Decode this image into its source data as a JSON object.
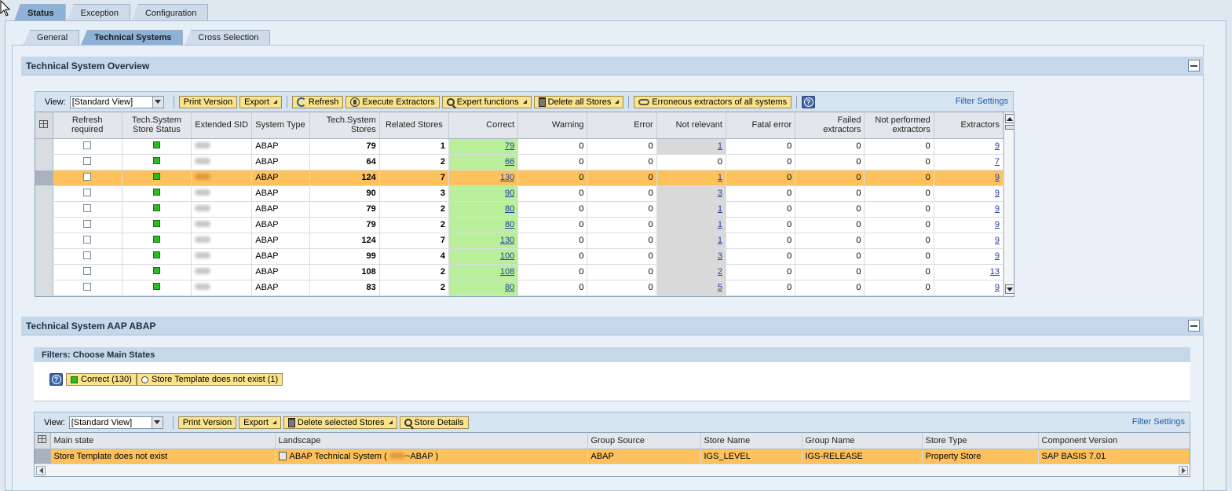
{
  "main_tabs": [
    "Status",
    "Exception",
    "Configuration"
  ],
  "sub_tabs": [
    "General",
    "Technical Systems",
    "Cross Selection"
  ],
  "overview": {
    "title": "Technical System Overview",
    "toolbar": {
      "view_label": "View:",
      "view_value": "[Standard View]",
      "print": "Print Version",
      "export": "Export",
      "refresh": "Refresh",
      "execute": "Execute Extractors",
      "expert": "Expert functions",
      "delete_all": "Delete all Stores",
      "erroneous": "Erroneous extractors of all systems",
      "help": "?",
      "filter_settings": "Filter Settings"
    },
    "columns": {
      "refresh": "Refresh required",
      "status": "Tech.System Store Status",
      "sid": "Extended SID",
      "systype": "System Type",
      "stores": "Tech.System Stores",
      "related": "Related Stores",
      "correct": "Correct",
      "warning": "Warning",
      "error": "Error",
      "notrel": "Not relevant",
      "fatal": "Fatal error",
      "failed": "Failed extractors",
      "notperf": "Not performed extractors",
      "extractors": "Extractors"
    },
    "rows": [
      {
        "type": "ABAP",
        "stores": "79",
        "related": "1",
        "correct": "79",
        "warning": "0",
        "error": "0",
        "notrel": "1",
        "fatal": "0",
        "failed": "0",
        "notperf": "0",
        "extractors": "9"
      },
      {
        "type": "ABAP",
        "stores": "64",
        "related": "2",
        "correct": "66",
        "warning": "0",
        "error": "0",
        "notrel": "0",
        "fatal": "0",
        "failed": "0",
        "notperf": "0",
        "extractors": "7"
      },
      {
        "type": "ABAP",
        "stores": "124",
        "related": "7",
        "correct": "130",
        "warning": "0",
        "error": "0",
        "notrel": "1",
        "fatal": "0",
        "failed": "0",
        "notperf": "0",
        "extractors": "9"
      },
      {
        "type": "ABAP",
        "stores": "90",
        "related": "3",
        "correct": "90",
        "warning": "0",
        "error": "0",
        "notrel": "3",
        "fatal": "0",
        "failed": "0",
        "notperf": "0",
        "extractors": "9"
      },
      {
        "type": "ABAP",
        "stores": "79",
        "related": "2",
        "correct": "80",
        "warning": "0",
        "error": "0",
        "notrel": "1",
        "fatal": "0",
        "failed": "0",
        "notperf": "0",
        "extractors": "9"
      },
      {
        "type": "ABAP",
        "stores": "79",
        "related": "2",
        "correct": "80",
        "warning": "0",
        "error": "0",
        "notrel": "1",
        "fatal": "0",
        "failed": "0",
        "notperf": "0",
        "extractors": "9"
      },
      {
        "type": "ABAP",
        "stores": "124",
        "related": "7",
        "correct": "130",
        "warning": "0",
        "error": "0",
        "notrel": "1",
        "fatal": "0",
        "failed": "0",
        "notperf": "0",
        "extractors": "9"
      },
      {
        "type": "ABAP",
        "stores": "99",
        "related": "4",
        "correct": "100",
        "warning": "0",
        "error": "0",
        "notrel": "3",
        "fatal": "0",
        "failed": "0",
        "notperf": "0",
        "extractors": "9"
      },
      {
        "type": "ABAP",
        "stores": "108",
        "related": "2",
        "correct": "108",
        "warning": "0",
        "error": "0",
        "notrel": "2",
        "fatal": "0",
        "failed": "0",
        "notperf": "0",
        "extractors": "13"
      },
      {
        "type": "ABAP",
        "stores": "83",
        "related": "2",
        "correct": "80",
        "warning": "0",
        "error": "0",
        "notrel": "5",
        "fatal": "0",
        "failed": "0",
        "notperf": "0",
        "extractors": "9"
      }
    ]
  },
  "detail": {
    "title": "Technical System AAP ABAP",
    "filters_title": "Filters: Choose Main States",
    "filter_correct": "Correct (130)",
    "filter_template": "Store Template does not exist (1)",
    "toolbar": {
      "view_label": "View:",
      "view_value": "[Standard View]",
      "print": "Print Version",
      "export": "Export",
      "delete_selected": "Delete selected Stores",
      "store_details": "Store Details",
      "filter_settings": "Filter Settings"
    },
    "columns": {
      "main_state": "Main state",
      "landscape": "Landscape",
      "group_source": "Group Source",
      "store_name": "Store Name",
      "group_name": "Group Name",
      "store_type": "Store Type",
      "component_version": "Component Version"
    },
    "row": {
      "main_state": "Store Template does not exist",
      "landscape_prefix": "ABAP Technical System (",
      "landscape_suffix": "~ABAP )",
      "group_source": "ABAP",
      "store_name": "IGS_LEVEL",
      "group_name": "IGS-RELEASE",
      "store_type": "Property Store",
      "component_version": "SAP BASIS 7.01"
    }
  },
  "colors": {
    "selected_row": "#fdc25e",
    "correct_cell": "#b9ee9a",
    "button_yellow": "#fbe38b",
    "header_blue": "#c5d8ea"
  }
}
